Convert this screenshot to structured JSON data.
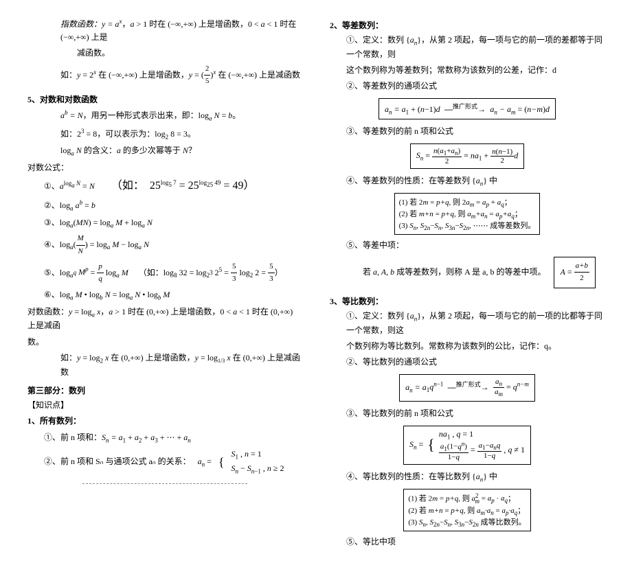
{
  "left": {
    "expfun1": "指数函数：y = aˣ，a > 1 时在 (−∞,+∞) 上是增函数，0 < a < 1 时在 (−∞,+∞) 上是减函数。",
    "expfun2": "如：y = 2ˣ 在 (−∞,+∞) 上是增函数，y = (2/5)ˣ 在 (−∞,+∞) 上是减函数",
    "sec5": "5、对数和对数函数",
    "log1": "aᵇ = N，用另一种形式表示出来，即：logₐ N = b。",
    "log2": "如：2³ = 8，可以表示为：log₂ 8 = 3。",
    "log3": "logₐ N 的含义：a 的多少次幂等于 N？",
    "logformula": "对数公式：",
    "f1a": "①、a^(logₐ N) = N",
    "f1b": "（如：25^(log₅ 7) = 25^(log₂₅ 49) = 49）",
    "f2": "②、logₐ aᵇ = b",
    "f3": "③、logₐ(MN) = logₐ M + logₐ N",
    "f4": "④、logₐ(M/N) = logₐ M − logₐ N",
    "f5a": "⑤、log_(aᵍ) Mᵖ = (p/q) logₐ M",
    "f5b": "（如：log₈ 32 = log_(2³) 2⁵ = (5/3) log₂ 2 = 5/3）",
    "f6": "⑥、logₐ M · log_b N = logₐ N · log_b M",
    "logfun1": "对数函数：y = logₐ x，a > 1 时在 (0,+∞) 上是增函数，0 < a < 1 时在 (0,+∞) 上是减函数。",
    "logfun2": "如：y = log₂ x 在 (0,+∞) 上是增函数，y = log_(1/3) x 在 (0,+∞) 上是减函数",
    "part3": "第三部分：数列",
    "know": "【知识点】",
    "seq1": "1、所有数列：",
    "seq1a": "①、前 n 项和：Sₙ = a₁ + a₂ + a₃ + ⋯ + aₙ",
    "seq1b_pre": "②、前 n 项和 Sₙ 与通项公式 aₙ 的关系：",
    "seq1b_case1": "S₁ , n = 1",
    "seq1b_case2": "Sₙ − Sₙ₋₁ , n ≥ 2",
    "seq1b_an": "aₙ ="
  },
  "right": {
    "sec2": "2、等差数列：",
    "d1": "①、定义：数列 {aₙ}，从第 2 项起，每一项与它的前一项的差都等于同一个常数，则这个数列称为等差数列；常数称为该数列的公差，记作：d",
    "d2": "②、等差数列的通项公式",
    "d2box_a": "aₙ = a₁ + (n−1)d",
    "d2box_mid": "推广形式",
    "d2box_b": "aₙ − aₘ = (n−m)d",
    "d3": "③、等差数列的前 n 项和公式",
    "d3box": "Sₙ = n(a₁+aₙ)/2 = na₁ + n(n−1)d/2",
    "d4": "④、等差数列的性质：在等差数列 {aₙ} 中",
    "d4l1": "(1) 若 2m = p+q, 则 2aₘ = aₚ + a_q；",
    "d4l2": "(2) 若 m+n = p+q, 则 aₘ+aₙ = aₚ+a_q；",
    "d4l3": "(3) Sₙ, S₂ₙ−Sₙ, S₃ₙ−S₂ₙ, ⋯⋯ 成等差数列。",
    "d5": "⑤、等差中项：",
    "d5text": "若 a, A, b 成等差数列，则称 A 是 a, b 的等差中项。",
    "d5box": "A = (a+b)/2",
    "sec3": "3、等比数列：",
    "g1": "①、定义：数列 {aₙ}，从第 2 项起，每一项与它的前一项的比都等于同一个常数，则这个数列称为等比数列。常数称为该数列的公比，记作：q。",
    "g2": "②、等比数列的通项公式",
    "g2box_a": "aₙ = a₁ qⁿ⁻¹",
    "g2box_mid": "推广形式",
    "g2box_b": "aₙ / aₘ = qⁿ⁻ᵐ",
    "g3": "③、等比数列的前 n 项和公式",
    "g3l1": "na₁ , q = 1",
    "g3l2": "a₁(1−qⁿ)/(1−q) = (a₁−aₙq)/(1−q) , q ≠ 1",
    "g3sn": "Sₙ =",
    "g4": "④、等比数列的性质：在等比数列 {aₙ} 中",
    "g4l1": "(1) 若 2m = p+q, 则 aₘ² = aₚ · a_q；",
    "g4l2": "(2) 若 m+n = p+q, 则 aₘ·aₙ = aₚ·a_q；",
    "g4l3": "(3) Sₙ, S₂ₙ−Sₙ, S₃ₙ−S₂ₙ 成等比数列。",
    "g5": "⑤、等比中项"
  }
}
